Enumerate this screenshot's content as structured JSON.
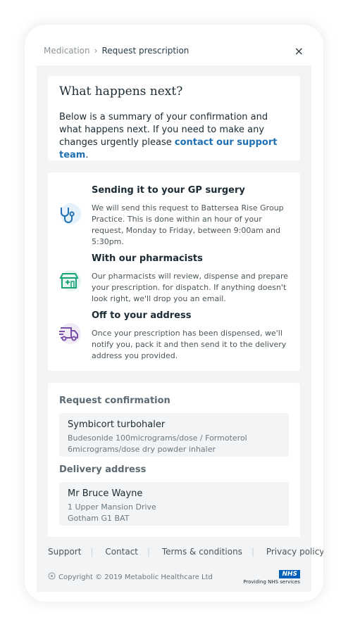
{
  "breadcrumb": {
    "parent": "Medication",
    "separator": "›",
    "current": "Request prescription",
    "close_glyph": "×"
  },
  "summary_card": {
    "title": "What happens next?",
    "body_prefix": "Below is a summary of your confirmation and what happens next. If you need to make any changes urgently please ",
    "link_text": "contact our support team",
    "body_suffix": "."
  },
  "steps": [
    {
      "icon": "stethoscope-icon",
      "title": "Sending it to your GP surgery",
      "text": "We will send this request to Battersea Rise Group Practice. This is done within an hour of your request, Monday to Friday, between 9:00am and 5:30pm."
    },
    {
      "icon": "pharmacy-icon",
      "title": "With our pharmacists",
      "text": "Our pharmacists will review, dispense and prepare your prescription. for dispatch. If anything doesn't look right, we'll drop you an email."
    },
    {
      "icon": "delivery-van-icon",
      "title": "Off to your address",
      "text": "Once your prescription has been dispensed, we'll notify you, pack it and then send it to the delivery address you provided."
    }
  ],
  "confirmation": {
    "heading": "Request confirmation",
    "item_name": "Symbicort turbohaler",
    "item_detail": "Budesonide 100micrograms/dose / Formoterol 6micrograms/dose dry powder inhaler"
  },
  "delivery": {
    "heading": "Delivery address",
    "name": "Mr Bruce Wayne",
    "line1": "1 Upper Mansion Drive",
    "line2": "Gotham G1 BAT"
  },
  "footer": {
    "links": [
      "Support",
      "Contact",
      "Terms & conditions",
      "Privacy policy"
    ],
    "copyright": "Copyright © 2019 Metabolic Healthcare Ltd",
    "nhs_logo": "NHS",
    "nhs_text": "Providing NHS services"
  },
  "colors": {
    "link": "#1f6fb2",
    "stethoscope": "#1f6fb2",
    "pharmacy": "#1aa37a",
    "van": "#7b4fa8"
  }
}
